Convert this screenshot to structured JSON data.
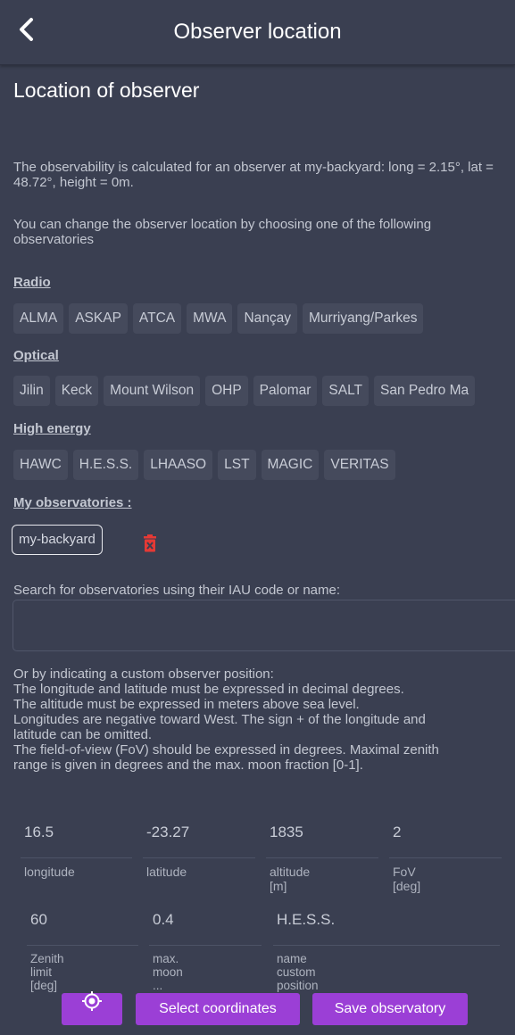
{
  "header": {
    "title": "Observer location",
    "back_icon": "chevron-left-icon"
  },
  "page_title": "Location of observer",
  "intro": "The observability is calculated for an observer at my-backyard: long = 2.15°, lat = 48.72°, height = 0m.",
  "change_hint": "You can change the observer location by choosing one of the following observatories",
  "sections": {
    "radio": {
      "label": "Radio",
      "items": [
        "ALMA",
        "ASKAP",
        "ATCA",
        "MWA",
        "Nançay",
        "Murriyang/Parkes"
      ]
    },
    "optical": {
      "label": "Optical",
      "items": [
        "Jilin",
        "Keck",
        "Mount Wilson",
        "OHP",
        "Palomar",
        "SALT",
        "San Pedro Ma"
      ]
    },
    "high_energy": {
      "label": "High energy",
      "items": [
        "HAWC",
        "H.E.S.S.",
        "LHAASO",
        "LST",
        "MAGIC",
        "VERITAS"
      ]
    },
    "mine": {
      "label": "My observatories :",
      "items": [
        "my-backyard"
      ],
      "delete_icon": "trash-icon",
      "delete_color": "#e53935"
    }
  },
  "search": {
    "label": "Search for observatories using their IAU code or name:",
    "value": ""
  },
  "custom_instructions": [
    "Or by indicating a custom observer position:",
    "The longitude and latitude must be expressed in decimal degrees.",
    "The altitude must be expressed in meters above sea level.",
    "Longitudes are negative toward West. The sign + of the longitude and",
    "latitude can be omitted.",
    "The field-of-view (FoV) should be expressed in degrees. Maximal zenith",
    "range is given in degrees and the max. moon fraction [0-1]."
  ],
  "fields": [
    {
      "value": "16.5",
      "label": "longitude"
    },
    {
      "value": "-23.27",
      "label": "latitude"
    },
    {
      "value": "1835",
      "label": "altitude [m]"
    },
    {
      "value": "2",
      "label": "FoV [deg]"
    },
    {
      "value": "60",
      "label": "Zenith limit [deg]"
    },
    {
      "value": "0.4",
      "label": "max. moon ..."
    },
    {
      "value": "H.E.S.S.",
      "label": "name custom position"
    }
  ],
  "buttons": {
    "locate_icon": "crosshair-location-icon",
    "select_coordinates": "Select coordinates",
    "save_observatory": "Save observatory",
    "accent": "#9b3fd6"
  }
}
